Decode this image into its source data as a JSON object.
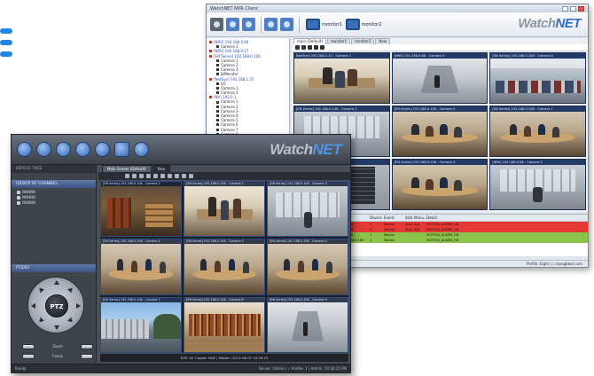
{
  "colors": {
    "brand_gray": "#8b96a3",
    "brand_blue": "#2f6fc0",
    "event_red": "#e53935",
    "event_green": "#8bc34a",
    "dark_panel": "#4a4f57",
    "panel_header_blue": "#3a5585"
  },
  "back_window": {
    "title": "WatchNET NVR Client",
    "brand": {
      "watch": "Watch",
      "net": "NET"
    },
    "toolbar": {
      "icons": [
        "camera-icon",
        "search-icon",
        "ptz-icon",
        "save-icon",
        "disk-icon"
      ],
      "monitor1_label": "monitor1",
      "monitor2_label": "monitor2"
    },
    "tree": [
      {
        "label": "[NRV] 192.168.0.66",
        "type": "site"
      },
      {
        "label": "Camera 1",
        "type": "cam"
      },
      {
        "label": "[NRV] 192.168.0.27",
        "type": "site"
      },
      {
        "label": "[EN Series] 192.168.0.106",
        "type": "site"
      },
      {
        "label": "Camera 1",
        "type": "cam"
      },
      {
        "label": "Camera 2",
        "type": "cam"
      },
      {
        "label": "Camera 3",
        "type": "cam"
      },
      {
        "label": "D/Monitor",
        "type": "cam"
      },
      {
        "label": "[NetEye] 192.168.1.37",
        "type": "site"
      },
      {
        "label": "I/O",
        "type": "cam"
      },
      {
        "label": "Camera 1",
        "type": "cam"
      },
      {
        "label": "Camera 2",
        "type": "cam"
      },
      {
        "label": "[NV] 192.0.1",
        "type": "site"
      },
      {
        "label": "Camera 1",
        "type": "cam"
      },
      {
        "label": "Camera 2",
        "type": "cam"
      },
      {
        "label": "Camera 3",
        "type": "cam"
      },
      {
        "label": "Camera 4",
        "type": "cam"
      },
      {
        "label": "Camera 5",
        "type": "cam"
      },
      {
        "label": "Camera 6",
        "type": "cam"
      },
      {
        "label": "Camera 7",
        "type": "cam"
      },
      {
        "label": "Camera 8",
        "type": "cam"
      },
      {
        "label": "Camera 9",
        "type": "cam"
      },
      {
        "label": "Camera 10",
        "type": "cam"
      }
    ],
    "tabs": [
      "main (Default)",
      "monitor1",
      "monitor2",
      "New"
    ],
    "cameras": [
      {
        "caption": "[NetEye] 192.168.1.37 - Camera 1",
        "scene": "office"
      },
      {
        "caption": "[NRV] 192.168.0.66 - Camera 4",
        "scene": "corridor"
      },
      {
        "caption": "[EN Series] 192.168.0.106 - Camera 4",
        "scene": "parking"
      },
      {
        "caption": "[EN Series] 192.168.0.106 - Camera 2",
        "scene": "lobby"
      },
      {
        "caption": "[EN Series] 192.168.0.106 - Camera 4",
        "scene": "meeting"
      },
      {
        "caption": "[EN Series] 192.168.0.106 - Camera 1",
        "scene": "meeting"
      },
      {
        "caption": "[NetEye] 192.168.1.37 - Camera 1",
        "scene": "server"
      },
      {
        "caption": "[EN Series] 192.168.0.106 - Camera 3",
        "scene": "meeting"
      },
      {
        "caption": "[NRV] 192.168.0.66 - Camera 5",
        "scene": "lobby"
      }
    ],
    "events": {
      "headers": [
        "",
        "Site",
        "Device",
        "Event",
        "Stat.",
        "Manu...",
        "Detail"
      ],
      "rows": [
        {
          "cells": [
            "2012-08-07",
            "[NRV] 192.168.0.66",
            "1",
            "Motion",
            "Alarm",
            "N/A",
            "MOTION_ALARM_ON"
          ],
          "color": "red"
        },
        {
          "cells": [
            "2012-08-07",
            "[NRV] 192.168.0.66",
            "1",
            "Motion",
            "Alarm",
            "N/A",
            "MOTION_ALARM_ON"
          ],
          "color": "red"
        },
        {
          "cells": [
            "2012-08-07",
            "[NRV] 192.168.0.78",
            "1",
            "Motion",
            "",
            "",
            "MOTION_ALARM_ON"
          ],
          "color": "green"
        },
        {
          "cells": [
            "2012-08-07",
            "[EN Series] 192.168.0.106",
            "1",
            "Motion",
            "",
            "",
            "MOTION_ALARM_ON"
          ],
          "color": "green"
        }
      ]
    },
    "status": "Profile: Eight | ☐ bongbbot.com"
  },
  "front_window": {
    "brand": {
      "watch": "Watch",
      "net": "NET"
    },
    "toolbar_icons": [
      "settings-icon",
      "search-icon",
      "play-icon",
      "ptz-icon",
      "globe-icon",
      "layout-icon",
      "help-icon"
    ],
    "device_tree_header": "DEVICE TREE",
    "site_header": "GROUP OF CHANNEL",
    "devices": [
      "NNNNN",
      "NNNNN",
      "NNNNN"
    ],
    "ptz_header": "PTZ/DI",
    "ptz_label": "PTZ",
    "ptz_controls": [
      "Zoom",
      "Focus",
      "Speed"
    ],
    "tabs": [
      "Main Screen (Default)",
      "New"
    ],
    "cameras": [
      {
        "caption": "[EN Series] 192.168.0.106 - Camera 1",
        "scene": "warehouse"
      },
      {
        "caption": "[EN Series] 192.168.0.106 - Camera 2",
        "scene": "office"
      },
      {
        "caption": "[EN Series] 192.168.0.106 - Camera 3",
        "scene": "lobby"
      },
      {
        "caption": "[EN Series] 192.168.0.106 - Camera 4",
        "scene": "meeting"
      },
      {
        "caption": "[EN Series] 192.168.0.106 - Camera 5",
        "scene": "meeting"
      },
      {
        "caption": "[EN Series] 192.168.0.106 - Camera 6",
        "scene": "meeting"
      },
      {
        "caption": "[EN Series] 192.168.0.106 - Camera 7",
        "scene": "exterior"
      },
      {
        "caption": "[EN Series] 192.168.0.106 - Camera 8",
        "scene": "library"
      },
      {
        "caption": "[EN Series] 192.168.0.106 - Camera 9",
        "scene": "corridor"
      }
    ],
    "info_bar": "DVR 16: Cooper NVR | Motion: 2012-08-07 10:26:15",
    "status_ready": "Ready",
    "status_right": "Server: Online | ✓ Profile: 1 | Admin: 10:26:15 PM"
  }
}
